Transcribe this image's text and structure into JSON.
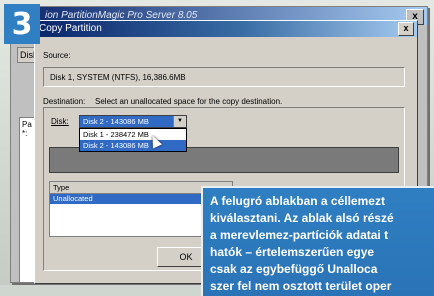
{
  "badge": {
    "number": "3"
  },
  "background_window": {
    "title": "ion PartitionMagic Pro Server 8.05",
    "close_glyph": "x",
    "tab_label": "Disk",
    "list_header": "Pa",
    "list_item": "*:"
  },
  "dialog": {
    "title": "Copy Partition",
    "close_glyph": "x",
    "source_label": "Source:",
    "source_value": "Disk 1, SYSTEM (NTFS), 16,386.6MB",
    "destination_label": "Destination:",
    "destination_hint": "Select an unallocated space for the copy destination.",
    "disk_label": "Disk:",
    "disk_selected": "Disk 2 - 143086 MB",
    "disk_options": [
      {
        "label": "Disk 1 - 238472 MB",
        "selected": false
      },
      {
        "label": "Disk 2 - 143086 MB",
        "selected": true
      }
    ],
    "type_table": {
      "header": "Type",
      "rows": [
        "Unallocated"
      ]
    },
    "ok_button": "OK"
  },
  "caption": {
    "lines": [
      "A felugró ablakban a céllemezt",
      "kiválasztani. Az ablak alsó részé",
      "a merevlemez-partíciók adatai t",
      "hatók – értelemszerűen egye",
      "csak az egybefüggő Unalloca",
      "szer fel nem osztott terület oper"
    ]
  },
  "colors": {
    "accent_blue": "#2f7fc2",
    "selection": "#316ac5",
    "titlebar": "#0a246a",
    "dialog_face": "#d4d0c8"
  }
}
